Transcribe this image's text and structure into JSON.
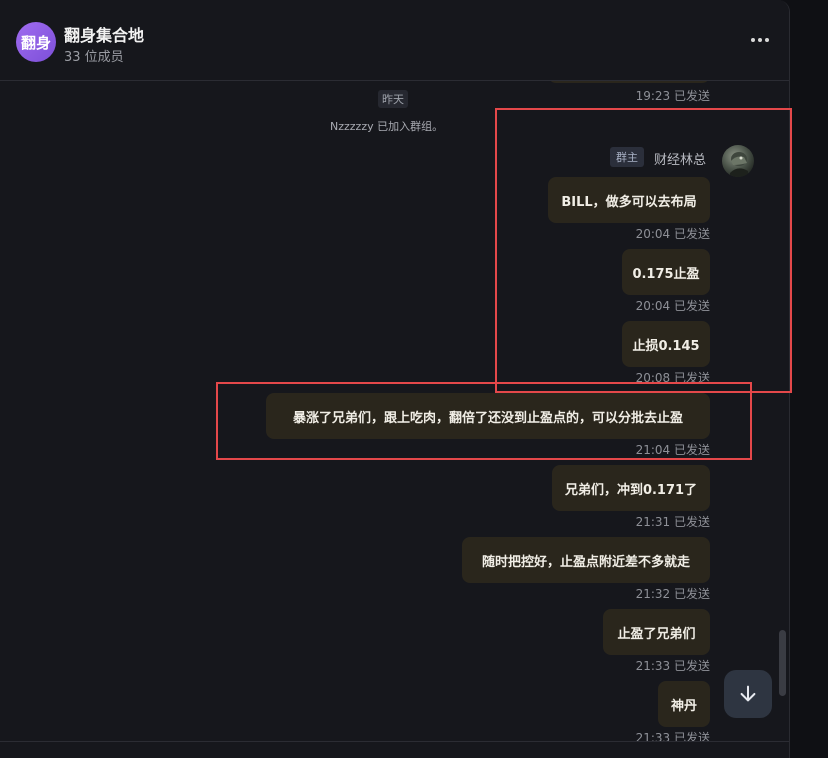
{
  "header": {
    "avatar_text": "翻身",
    "title": "翻身集合地",
    "member_count": "33 位成员"
  },
  "timeline": {
    "top_time": "19:23 已发送",
    "date_chip": "昨天",
    "system_message": "Nzzzzzy 已加入群组。"
  },
  "sender": {
    "badge": "群主",
    "name": "财经林总"
  },
  "messages": [
    {
      "text": "BILL，做多可以去布局",
      "time": "20:04 已发送"
    },
    {
      "text": "0.175止盈",
      "time": "20:04 已发送"
    },
    {
      "text": "止损0.145",
      "time": "20:08 已发送"
    },
    {
      "text": "暴涨了兄弟们，跟上吃肉，翻倍了还没到止盈点的，可以分批去止盈",
      "time": "21:04 已发送"
    },
    {
      "text": "兄弟们，冲到0.171了",
      "time": "21:31 已发送"
    },
    {
      "text": "随时把控好，止盈点附近差不多就走",
      "time": "21:32 已发送"
    },
    {
      "text": "止盈了兄弟们",
      "time": "21:33 已发送"
    },
    {
      "text": "神丹",
      "time": "21:33 已发送"
    }
  ],
  "icons": {
    "more": "more-dots-icon",
    "scroll_down": "arrow-down-icon"
  },
  "colors": {
    "bubble": "#2a261c",
    "annotation": "#e4484a",
    "avatar": "#8b5cf6"
  }
}
